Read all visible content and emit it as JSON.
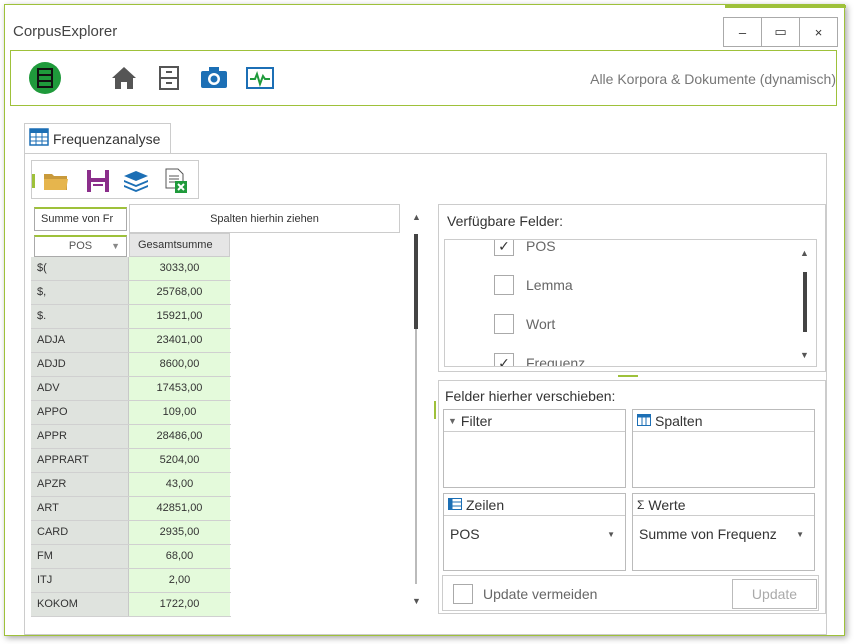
{
  "window": {
    "title": "CorpusExplorer",
    "minimize_label": "–",
    "maximize_label": "▭",
    "close_label": "×"
  },
  "ribbon": {
    "icons": [
      "corpus-icon",
      "home-icon",
      "cabinet-icon",
      "camera-icon",
      "monitor-icon"
    ],
    "scope_label": "Alle Korpora & Dokumente (dynamisch)"
  },
  "tab": {
    "label": "Frequenzanalyse",
    "icon": "table-icon"
  },
  "toolbar": {
    "icons": [
      "open-folder-icon",
      "save-icon",
      "layers-icon",
      "export-excel-icon"
    ]
  },
  "pivot": {
    "data_field_label": "Summe von Fr",
    "column_drop_label": "Spalten hierhin ziehen",
    "row_field_label": "POS",
    "total_header": "Gesamtsumme",
    "rows": [
      {
        "label": "$(",
        "value": "3033,00"
      },
      {
        "label": "$,",
        "value": "25768,00"
      },
      {
        "label": "$.",
        "value": "15921,00"
      },
      {
        "label": "ADJA",
        "value": "23401,00"
      },
      {
        "label": "ADJD",
        "value": "8600,00"
      },
      {
        "label": "ADV",
        "value": "17453,00"
      },
      {
        "label": "APPO",
        "value": "109,00"
      },
      {
        "label": "APPR",
        "value": "28486,00"
      },
      {
        "label": "APPRART",
        "value": "5204,00"
      },
      {
        "label": "APZR",
        "value": "43,00"
      },
      {
        "label": "ART",
        "value": "42851,00"
      },
      {
        "label": "CARD",
        "value": "2935,00"
      },
      {
        "label": "FM",
        "value": "68,00"
      },
      {
        "label": "ITJ",
        "value": "2,00"
      },
      {
        "label": "KOKOM",
        "value": "1722,00"
      }
    ]
  },
  "field_list": {
    "title": "Verfügbare Felder:",
    "items": [
      {
        "label": "POS",
        "checked": "✓"
      },
      {
        "label": "Lemma",
        "checked": ""
      },
      {
        "label": "Wort",
        "checked": ""
      },
      {
        "label": "Frequenz",
        "checked": "✓"
      }
    ]
  },
  "areas": {
    "title": "Felder hierher verschieben:",
    "filter_label": "Filter",
    "columns_label": "Spalten",
    "rows_label": "Zeilen",
    "rows_value": "POS",
    "values_label": "Werte",
    "values_value": "Summe von Frequenz",
    "defer_update_label": "Update vermeiden",
    "update_button_label": "Update"
  },
  "colors": {
    "accent": "#9ec13a",
    "row_label_bg": "#dfe3de",
    "value_bg": "#e4fadb"
  }
}
